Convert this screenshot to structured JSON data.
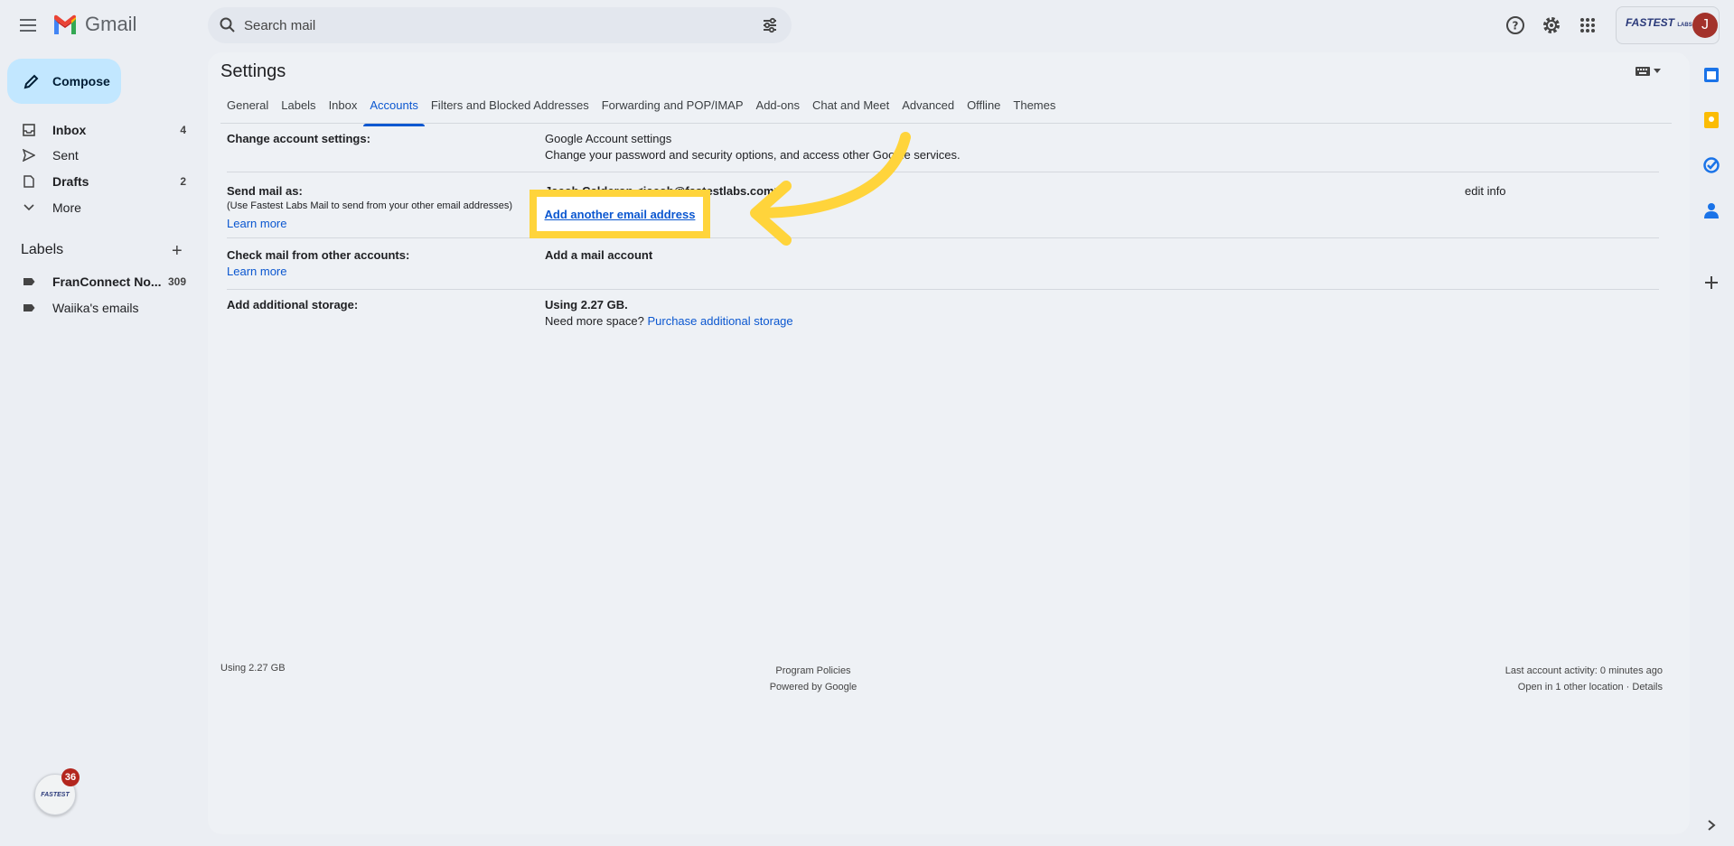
{
  "app": {
    "name": "Gmail"
  },
  "search": {
    "placeholder": "Search mail"
  },
  "header": {
    "org_logo_text": "FASTEST",
    "org_logo_sub": "LABS",
    "avatar_letter": "J"
  },
  "sidebar": {
    "compose_label": "Compose",
    "items": [
      {
        "label": "Inbox",
        "count": "4"
      },
      {
        "label": "Sent",
        "count": ""
      },
      {
        "label": "Drafts",
        "count": "2"
      },
      {
        "label": "More",
        "count": ""
      }
    ],
    "labels_title": "Labels",
    "labels": [
      {
        "label": "FranConnect No...",
        "count": "309"
      },
      {
        "label": "Waiika's emails",
        "count": ""
      }
    ],
    "chat_badge": "36"
  },
  "settings": {
    "title": "Settings",
    "tabs": [
      "General",
      "Labels",
      "Inbox",
      "Accounts",
      "Filters and Blocked Addresses",
      "Forwarding and POP/IMAP",
      "Add-ons",
      "Chat and Meet",
      "Advanced",
      "Offline",
      "Themes"
    ],
    "active_tab": "Accounts",
    "rows": {
      "change_account": {
        "heading": "Change account settings:",
        "link": "Google Account settings",
        "desc": "Change your password and security options, and access other Google services."
      },
      "send_mail": {
        "heading": "Send mail as:",
        "sub": "(Use Fastest Labs Mail to send from your other email addresses)",
        "learn_more": "Learn more",
        "account": "Jacob Calderon <jacob@fastestlabs.com>",
        "edit_info": "edit info",
        "add_link": "Add another email address"
      },
      "check_mail": {
        "heading": "Check mail from other accounts:",
        "learn_more": "Learn more",
        "add_link": "Add a mail account"
      },
      "storage": {
        "heading": "Add additional storage:",
        "using": "Using 2.27 GB.",
        "need_more": "Need more space?",
        "purchase_link": "Purchase additional storage"
      }
    },
    "footer": {
      "storage": "Using 2.27 GB",
      "program_policies": "Program Policies",
      "powered_by": "Powered by Google",
      "last_activity": "Last account activity: 0 minutes ago",
      "other_location": "Open in 1 other location · Details"
    }
  },
  "colors": {
    "accent": "#0b57d0",
    "highlight": "#ffd43b",
    "compose_bg": "#c2e7ff"
  }
}
